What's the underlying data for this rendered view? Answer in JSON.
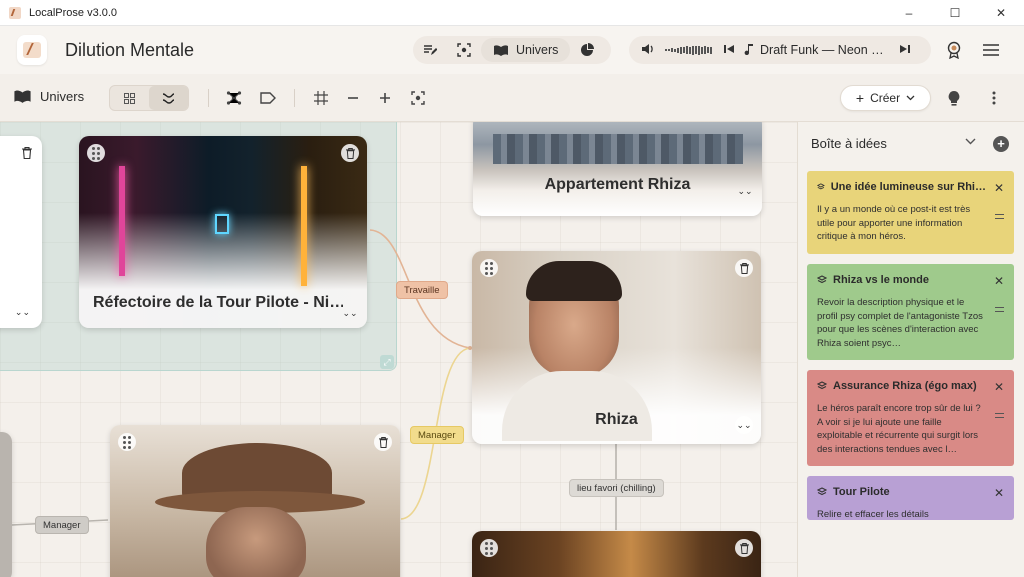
{
  "window": {
    "title": "LocalProse v3.0.0",
    "minimize": "–",
    "maximize": "☐",
    "close": "✕"
  },
  "header": {
    "project_title": "Dilution Mentale",
    "univers_tab": "Univers",
    "player": {
      "track": "Draft Funk — Neon …"
    }
  },
  "toolbar": {
    "section_label": "Univers",
    "create_label": "Créer"
  },
  "canvas": {
    "cards": [
      {
        "id": "refectoire",
        "title": "Réfectoire de la Tour Pilote - Ni…"
      },
      {
        "id": "appartement",
        "title": "Appartement Rhiza"
      },
      {
        "id": "rhiza",
        "title": "Rhiza"
      }
    ],
    "edges": [
      {
        "label": "Travaille"
      },
      {
        "label": "Manager"
      },
      {
        "label": "lieu favori (chilling)"
      },
      {
        "label": "Manager"
      }
    ]
  },
  "ideas": {
    "title": "Boîte à idées",
    "colors": {
      "yellow": "#e8d47a",
      "green": "#9fca8c",
      "red": "#d98a86",
      "purple": "#b8a0d4"
    },
    "notes": [
      {
        "title": "Une idée lumineuse sur Rhi…",
        "body": "Il y a un monde où ce post-it est très utile pour apporter une information critique à mon héros."
      },
      {
        "title": "Rhiza vs le monde",
        "body": "Revoir la description physique et le profil psy complet de l'antagoniste Tzos pour que les scènes d'interaction avec Rhiza soient psyc…"
      },
      {
        "title": "Assurance Rhiza (égo max)",
        "body": "Le héros paraît encore trop sûr de lui ? A voir si je lui ajoute une faille exploitable et récurrente qui surgit lors des interactions tendues avec l…"
      },
      {
        "title": "Tour Pilote",
        "body": "Relire et effacer les détails"
      }
    ]
  }
}
